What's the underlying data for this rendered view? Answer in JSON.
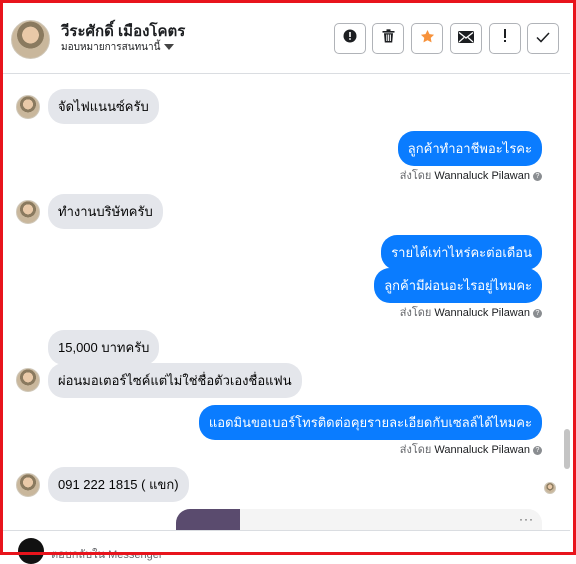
{
  "header": {
    "contact_name": "วีระศักดิ์ เมืองโคตร",
    "assigned_label": "มอบหมายการสนทนานี้",
    "actions": [
      {
        "name": "mark-spam-button",
        "icon": "alert-circle-icon"
      },
      {
        "name": "delete-button",
        "icon": "trash-icon"
      },
      {
        "name": "star-button",
        "icon": "star-icon"
      },
      {
        "name": "mark-unread-button",
        "icon": "envelope-icon"
      },
      {
        "name": "follow-up-button",
        "icon": "exclamation-icon"
      },
      {
        "name": "mark-done-button",
        "icon": "check-icon"
      }
    ]
  },
  "messages": [
    {
      "side": "in",
      "text": "จัดไฟแนนซ์ครับ"
    },
    {
      "side": "out",
      "text": "ลูกค้าทำอาชีพอะไรคะ"
    },
    {
      "side": "in",
      "text": "ทำงานบริษัทครับ"
    },
    {
      "side": "out",
      "text": "รายได้เท่าไหร่คะต่อเดือน"
    },
    {
      "side": "out",
      "text": "ลูกค้ามีผ่อนอะไรอยู่ไหมคะ"
    },
    {
      "side": "in",
      "text": "15,000 บาทครับ"
    },
    {
      "side": "in",
      "text": "ผ่อนมอเตอร์ไซค์แต่ไม่ใช่ชื่อตัวเองชื่อแฟน"
    },
    {
      "side": "out",
      "text": "แอดมินขอเบอร์โทรติดต่อคุยรายละเอียดกับเซลล์ได้ไหมคะ"
    },
    {
      "side": "in",
      "text": "091 222 1815  ( แขก)"
    }
  ],
  "sent_by": {
    "prefix": "ส่งโดย",
    "agent": "Wannaluck Pilawan"
  },
  "composer": {
    "placeholder": "ตอบกลับใน Messenger"
  },
  "colors": {
    "outgoing_bubble": "#0a7cff",
    "incoming_bubble": "#e4e6eb",
    "frame": "#e8141c",
    "star": "#f7923b"
  }
}
